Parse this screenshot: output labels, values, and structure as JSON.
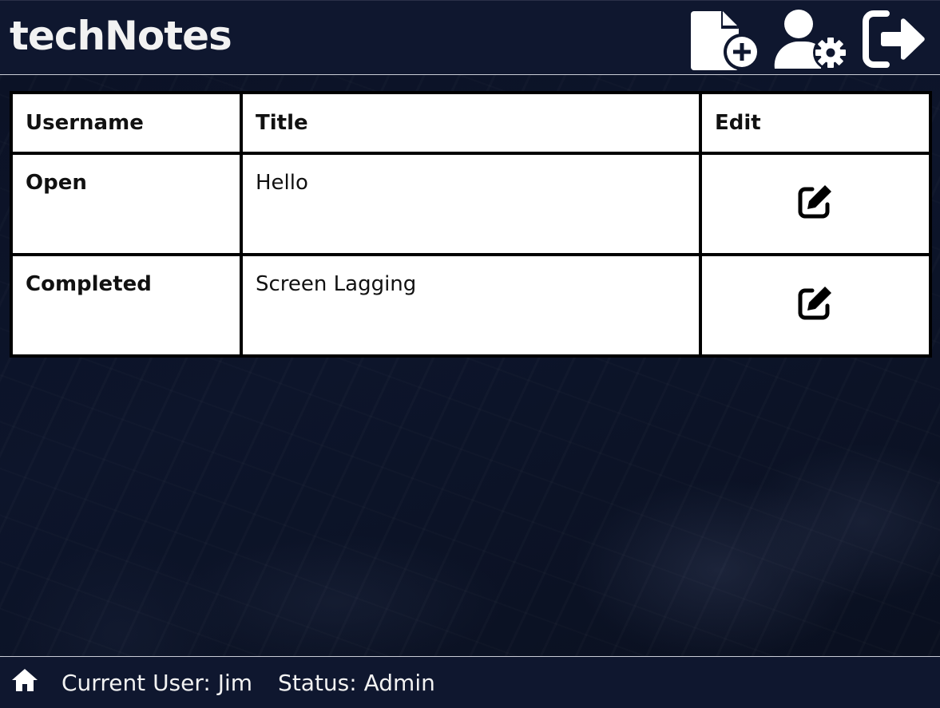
{
  "header": {
    "title": "techNotes",
    "buttons": [
      {
        "icon": "file-circle-plus-icon"
      },
      {
        "icon": "user-gear-icon"
      },
      {
        "icon": "right-from-bracket-icon"
      }
    ]
  },
  "table": {
    "headers": {
      "username": "Username",
      "title": "Title",
      "edit": "Edit"
    },
    "rows": [
      {
        "username": "Open",
        "title": "Hello",
        "status_color": "#a12b2b",
        "edit_icon": "pen-to-square-icon"
      },
      {
        "username": "Completed",
        "title": "Screen Lagging",
        "status_color": "#3ec23e",
        "edit_icon": "pen-to-square-icon"
      }
    ]
  },
  "footer": {
    "home_icon": "house-icon",
    "current_user": "Current User: Jim",
    "status": "Status: Admin"
  },
  "colors": {
    "header_bg": "#0f172f",
    "footer_bg": "#0f172f",
    "open": "#a12b2b",
    "completed": "#3ec23e"
  }
}
